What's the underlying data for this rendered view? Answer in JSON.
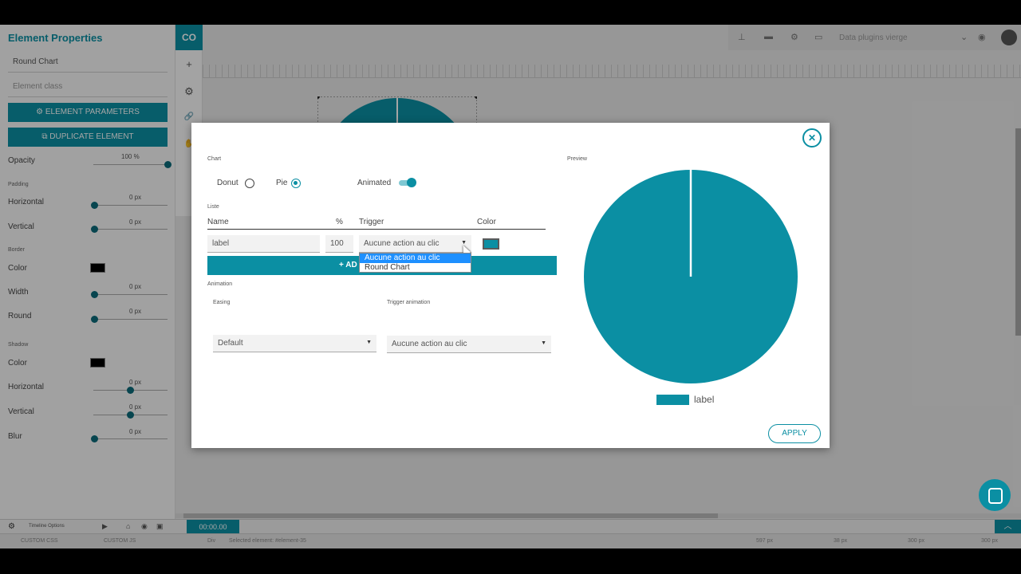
{
  "left_panel": {
    "title": "Element Properties",
    "name_field": "Round Chart",
    "class_placeholder": "Element class",
    "btn_params": "ELEMENT PARAMETERS",
    "btn_duplicate": "DUPLICATE ELEMENT",
    "opacity_label": "Opacity",
    "opacity_value": "100",
    "opacity_unit": "%",
    "padding_section": "Padding",
    "horizontal": "Horizontal",
    "vertical": "Vertical",
    "zero_px": "0 px",
    "border_section": "Border",
    "color": "Color",
    "width": "Width",
    "round": "Round",
    "shadow_section": "Shadow",
    "blur": "Blur"
  },
  "toolbar": {
    "logo": "CO",
    "plus_icon": "+",
    "settings_icon": "⚙",
    "link_icon": "🔗",
    "hand_icon": "✋"
  },
  "top_right": {
    "project_name": "Data plugins vierge"
  },
  "modal": {
    "chart_section": "Chart",
    "donut_label": "Donut",
    "pie_label": "Pie",
    "animated_label": "Animated",
    "liste_section": "Liste",
    "col_name": "Name",
    "col_percent": "%",
    "col_trigger": "Trigger",
    "col_color": "Color",
    "row_name": "label",
    "row_percent": "100",
    "row_trigger": "Aucune action au clic",
    "row_color": "#0b8fa3",
    "dropdown_options": [
      "Aucune action au clic",
      "Round Chart"
    ],
    "add_label": "AD",
    "animation_section": "Animation",
    "easing_label": "Easing",
    "easing_value": "Default",
    "trigger_anim_label": "Trigger animation",
    "trigger_anim_value": "Aucune action au clic",
    "preview_section": "Preview",
    "legend_label": "label",
    "apply": "APPLY",
    "close_icon": "close-icon"
  },
  "timeline": {
    "options": "Timeline Options",
    "time": "00:00.00"
  },
  "status": {
    "custom_css": "CUSTOM CSS",
    "custom_js": "CUSTOM JS",
    "selected": "Selected element: #element-35",
    "left": "597 px",
    "top": "38 px",
    "w": "300 px",
    "h": "300 px",
    "div": "Div"
  },
  "chart_data": {
    "type": "pie",
    "categories": [
      "label"
    ],
    "values": [
      100
    ],
    "colors": [
      "#0b8fa3"
    ]
  }
}
